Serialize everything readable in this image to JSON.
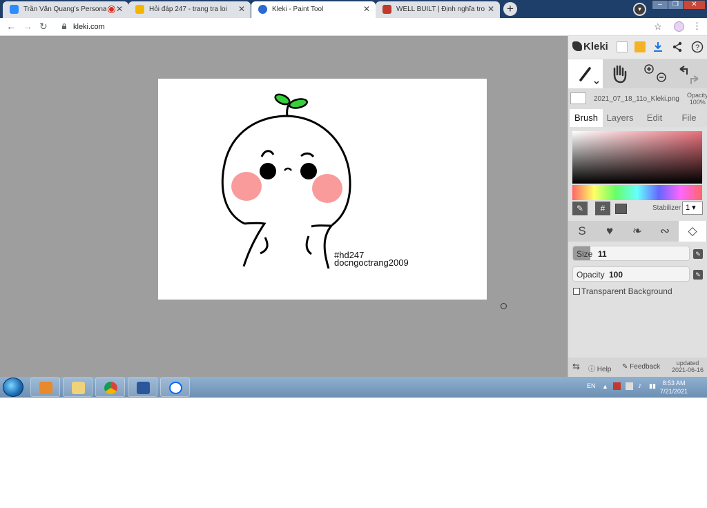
{
  "browser": {
    "tabs": [
      {
        "title": "Trần Văn Quang's Personal M",
        "icon": "zoom-icon",
        "recording": true,
        "active": false
      },
      {
        "title": "Hỏi đáp 247 - trang tra loi",
        "icon": "hoidap247-icon",
        "recording": false,
        "active": false
      },
      {
        "title": "Kleki - Paint Tool",
        "icon": "kleki-icon",
        "recording": false,
        "active": true
      },
      {
        "title": "WELL BUILT | Định nghĩa trong Ti",
        "icon": "cambridge-icon",
        "recording": false,
        "active": false
      }
    ],
    "url": "kleki.com",
    "theme_color": "#1f3f6b"
  },
  "canvas": {
    "hashtag_line1": "#hd247",
    "hashtag_line2": "docngoctrang2009",
    "blush_color": "#f87a7a",
    "sprout_color": "#36d03a"
  },
  "kleki": {
    "logo": "Kleki",
    "file_name": "2021_07_18_11o_Kleki.png",
    "opacity_label": "Opacity",
    "opacity_value": "100%",
    "tabs": [
      "Brush",
      "Layers",
      "Edit",
      "File"
    ],
    "active_tab": "Brush",
    "stabilizer_label": "Stabilizer",
    "stabilizer_value": "1",
    "hash_symbol": "#",
    "size_label": "Size",
    "size_value": "11",
    "size_fill_fraction": 0.15,
    "brush_opacity_label": "Opacity",
    "brush_opacity_value": "100",
    "brush_opacity_fill_fraction": 0.0,
    "transparent_bg_label": "Transparent Background",
    "help_label": "Help",
    "feedback_label": "Feedback",
    "updated_label": "updated",
    "updated_date": "2021-06-16"
  },
  "taskbar": {
    "lang": "EN",
    "time": "8:53 AM",
    "date": "7/21/2021",
    "apps": [
      "start-button",
      "media-player",
      "file-explorer",
      "chrome",
      "word",
      "zalo"
    ]
  }
}
